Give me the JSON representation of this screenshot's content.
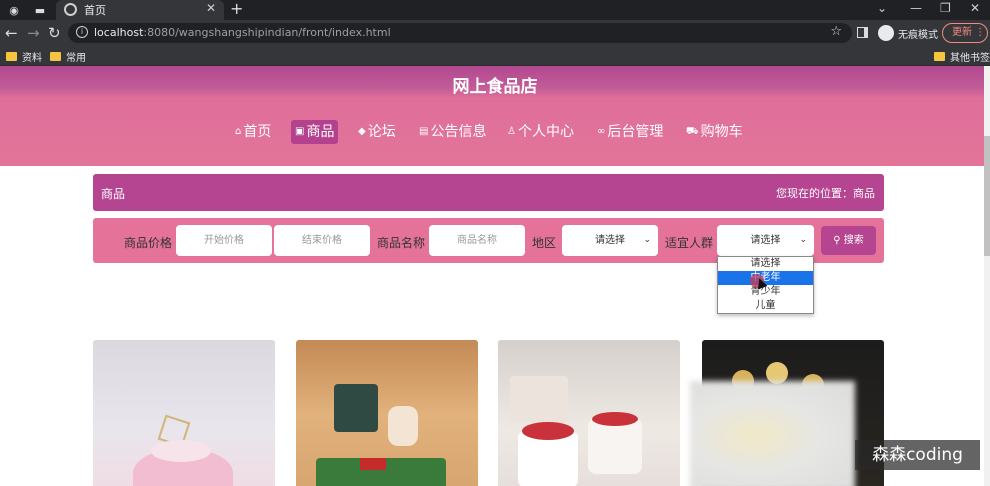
{
  "browser": {
    "tab_title": "首页",
    "url_host": "localhost",
    "url_rest": ":8080/wangshangshipindian/front/index.html",
    "profile_label": "无痕模式",
    "update_label": "更新",
    "bookmarks": [
      "资料",
      "常用"
    ],
    "other_bookmarks": "其他书签"
  },
  "site": {
    "title": "网上食品店",
    "nav": [
      {
        "icon": "home-icon",
        "glyph": "⌂",
        "label": "首页"
      },
      {
        "icon": "gift-icon",
        "glyph": "▣",
        "label": "商品"
      },
      {
        "icon": "graduation-cap-icon",
        "glyph": "◆",
        "label": "论坛"
      },
      {
        "icon": "notice-icon",
        "glyph": "▤",
        "label": "公告信息"
      },
      {
        "icon": "user-icon",
        "glyph": "♙",
        "label": "个人中心"
      },
      {
        "icon": "link-icon",
        "glyph": "∞",
        "label": "后台管理"
      },
      {
        "icon": "cart-icon",
        "glyph": "⛟",
        "label": "购物车"
      }
    ]
  },
  "breadcrumb": {
    "section": "商品",
    "location": "您现在的位置：商品"
  },
  "filters": {
    "price_label": "商品价格",
    "min_price_placeholder": "开始价格",
    "max_price_placeholder": "结束价格",
    "name_label": "商品名称",
    "name_placeholder": "商品名称",
    "region_label": "地区",
    "region_value": "请选择",
    "audience_label": "适宜人群",
    "audience_value": "请选择",
    "search_label": "搜索"
  },
  "audience_dropdown": {
    "options": [
      "请选择",
      "中老年",
      "青少年",
      "儿童"
    ],
    "highlighted": "中老年"
  },
  "watermark": "森森coding"
}
